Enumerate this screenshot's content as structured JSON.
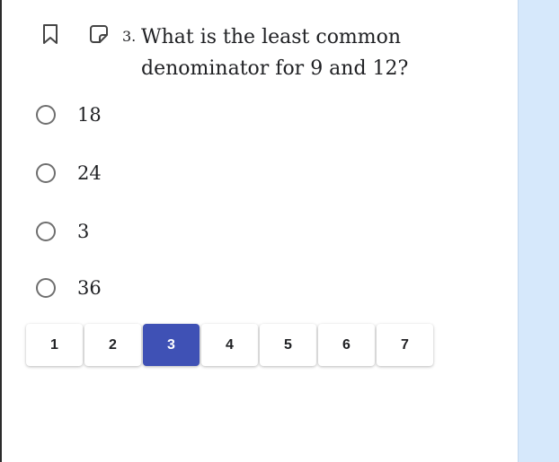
{
  "question": {
    "number": "3.",
    "text": "What is the least common denominator for 9 and 12?",
    "bookmark_icon": "bookmark-icon",
    "note_icon": "sticky-note-icon"
  },
  "options": [
    {
      "label": "18",
      "selected": false
    },
    {
      "label": "24",
      "selected": false
    },
    {
      "label": "3",
      "selected": false
    },
    {
      "label": "36",
      "selected": false
    }
  ],
  "pagination": {
    "pages": [
      "1",
      "2",
      "3",
      "4",
      "5",
      "6",
      "7"
    ],
    "current": "3"
  },
  "colors": {
    "active_page": "#3f51b5",
    "side_panel": "#d6e8fb"
  }
}
